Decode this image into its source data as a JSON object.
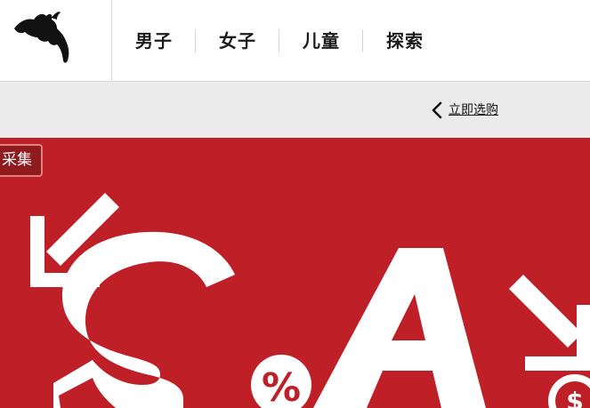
{
  "header": {
    "logo_icon": "puma-cat-icon",
    "nav": [
      {
        "label": "男子"
      },
      {
        "label": "女子"
      },
      {
        "label": "儿童"
      },
      {
        "label": "探索"
      }
    ]
  },
  "band": {
    "back_icon": "chevron-left-icon",
    "back_label": "立即选购"
  },
  "banner": {
    "collect_label": "采集",
    "colors": {
      "background": "#bf1f27",
      "graphic": "#ffffff"
    },
    "sale_glyphs": {
      "percent": "%"
    }
  }
}
